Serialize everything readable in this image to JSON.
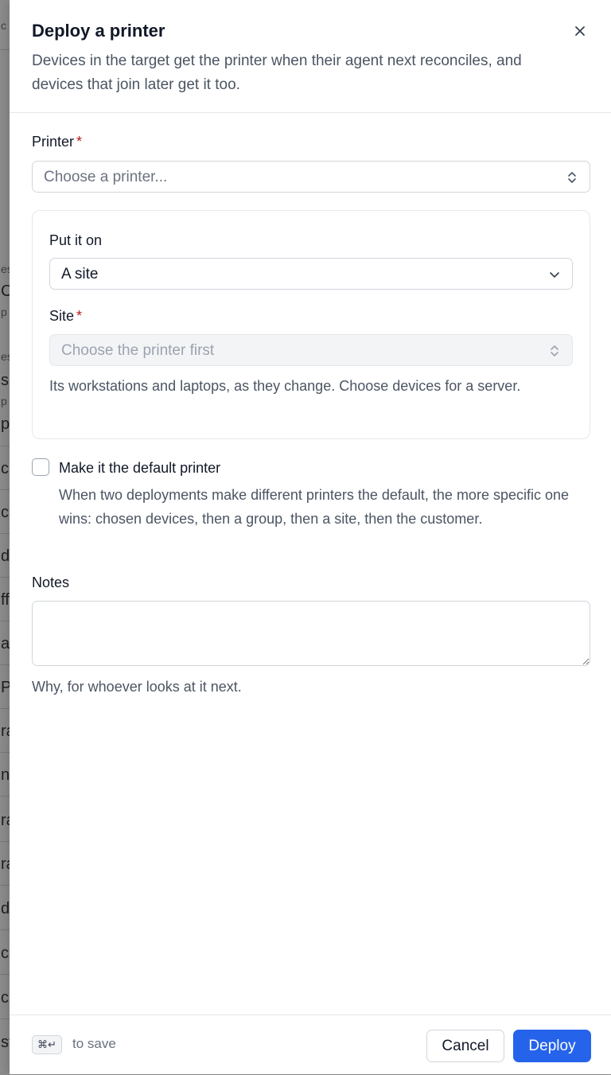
{
  "background": {
    "fragments": [
      "c",
      "es",
      "C",
      "p",
      "es",
      "s",
      "p",
      "p",
      "c",
      "c",
      "d",
      "ff",
      "a",
      "P",
      "ra",
      "n",
      "ra",
      "ra",
      "d",
      "c",
      "c",
      "st"
    ]
  },
  "dialog": {
    "title": "Deploy a printer",
    "description": "Devices in the target get the printer when their agent next reconciles, and devices that join later get it too.",
    "close_icon": "close-icon"
  },
  "printer": {
    "label": "Printer",
    "required_mark": "*",
    "placeholder": "Choose a printer..."
  },
  "target": {
    "label": "Put it on",
    "value": "A site",
    "site_label": "Site",
    "site_required_mark": "*",
    "site_placeholder": "Choose the printer first",
    "hint": "Its workstations and laptops, as they change. Choose devices for a server."
  },
  "default_printer": {
    "label": "Make it the default printer",
    "checked": false,
    "hint": "When two deployments make different printers the default, the more specific one wins: chosen devices, then a group, then a site, then the customer."
  },
  "notes": {
    "label": "Notes",
    "value": "",
    "hint": "Why, for whoever looks at it next."
  },
  "footer": {
    "shortcut": "⌘↵",
    "shortcut_hint": "to save",
    "cancel_label": "Cancel",
    "deploy_label": "Deploy"
  },
  "colors": {
    "accent": "#2563eb",
    "required": "#b91c1c",
    "muted_text": "#4b5563"
  }
}
